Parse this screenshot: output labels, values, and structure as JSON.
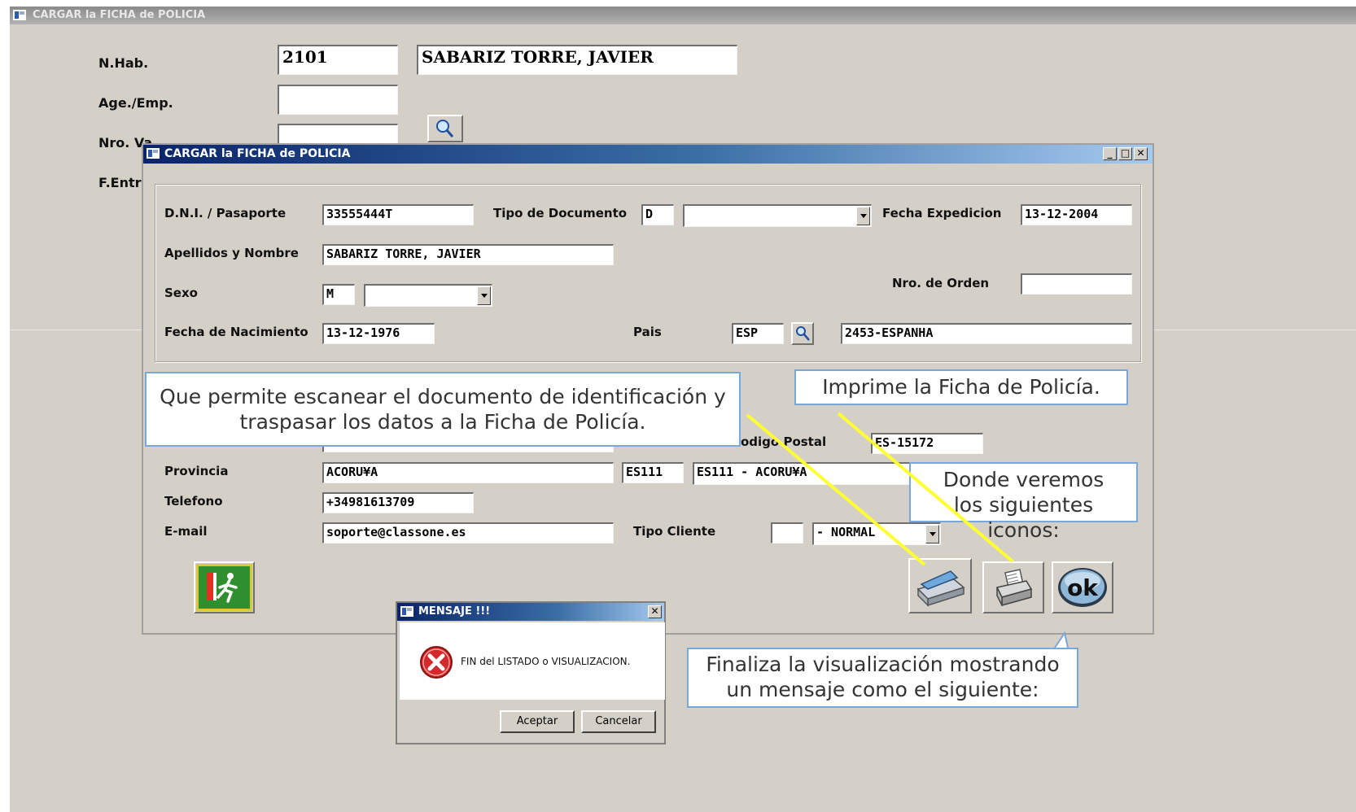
{
  "background_window": {
    "title": "CARGAR la FICHA de POLICIA",
    "labels": {
      "room": "N.Hab.",
      "agency": "Age./Emp.",
      "voucher": "Nro. Va",
      "entry": "F.Entra"
    },
    "room_value": "2101",
    "guest_value": "SABARIZ TORRE, JAVIER",
    "search_icon": "magnifier-icon"
  },
  "dialog": {
    "title": "CARGAR la FICHA de POLICIA",
    "controls": {
      "minimize": "_",
      "maximize": "□",
      "close": "✕"
    },
    "labels": {
      "dni": "D.N.I. / Pasaporte",
      "doc_type": "Tipo de Documento",
      "issue_date": "Fecha Expedicion",
      "name": "Apellidos y Nombre",
      "order_no": "Nro. de Orden",
      "sex": "Sexo",
      "birth_date": "Fecha de Nacimiento",
      "country": "Pais",
      "postal_code": "odigo Postal",
      "province": "Provincia",
      "phone": "Telefono",
      "email": "E-mail",
      "client_type": "Tipo Cliente"
    },
    "values": {
      "dni": "33555444T",
      "doc_type_code": "D",
      "doc_type_select": "",
      "issue_date": "13-12-2004",
      "name": "SABARIZ TORRE, JAVIER",
      "order_no": "",
      "sex_code": "M",
      "sex_select": "",
      "birth_date": "13-12-1976",
      "country_code": "ESP",
      "country_name": "2453-ESPANHA",
      "postal_code": "ES-15172",
      "province": "ACORU¥A",
      "province_code": "ES111",
      "province_name": "ES111 - ACORU¥A",
      "phone": "+34981613709",
      "email": "soporte@classone.es",
      "client_type_code": "",
      "client_type_select": "- NORMAL"
    },
    "buttons": {
      "exit": "exit-running-man-icon",
      "scan": "scanner-icon",
      "print": "printer-icon",
      "ok": "ok"
    }
  },
  "callouts": {
    "scan": "Que permite escanear el documento de identificación y traspasar los datos a la Ficha de Policía.",
    "print": "Imprime la Ficha de Policía.",
    "icons": "Donde veremos los siguientes iconos:",
    "finish": "Finaliza la visualización mostrando un mensaje como el siguiente:"
  },
  "message_box": {
    "title": "MENSAJE !!!",
    "close": "✕",
    "icon": "error-x-icon",
    "text": "FIN del LISTADO o VISUALIZACION.",
    "accept": "Aceptar",
    "cancel": "Cancelar"
  },
  "colors": {
    "callout_border": "#7aa7d9",
    "arrow_line": "#ffff33",
    "window_bg": "#d4d0c8"
  }
}
